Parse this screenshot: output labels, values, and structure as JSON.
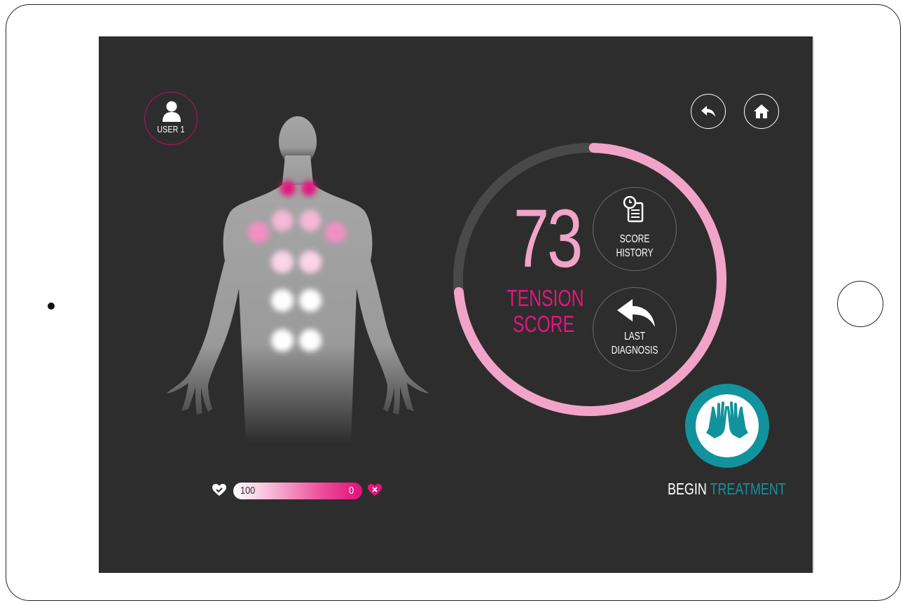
{
  "user": {
    "label": "USER 1",
    "icon": "user-icon"
  },
  "nav": {
    "back_icon": "back-arrow-icon",
    "home_icon": "home-icon"
  },
  "score": {
    "value": "73",
    "label_line1": "TENSION",
    "label_line2": "SCORE",
    "progress": 0.73,
    "ring_color": "#f2a4c8",
    "track_color": "#4a4949"
  },
  "score_history": {
    "label_line1": "SCORE",
    "label_line2": "HISTORY",
    "icon": "clock-document-icon"
  },
  "last_diagnosis": {
    "label_line1": "LAST",
    "label_line2": "DIAGNOSIS",
    "icon": "reply-arrow-icon"
  },
  "legend": {
    "left_value": "100",
    "right_value": "0",
    "left_icon": "heart-check-icon",
    "right_icon": "heart-x-icon"
  },
  "treatment": {
    "label_word1": "BEGIN",
    "label_word2": "TREATMENT",
    "icon": "hands-icon",
    "accent": "#11939e"
  },
  "colors": {
    "accent_pink": "#e3157f",
    "light_pink": "#f2a4c8",
    "background": "#2e2d2d"
  }
}
